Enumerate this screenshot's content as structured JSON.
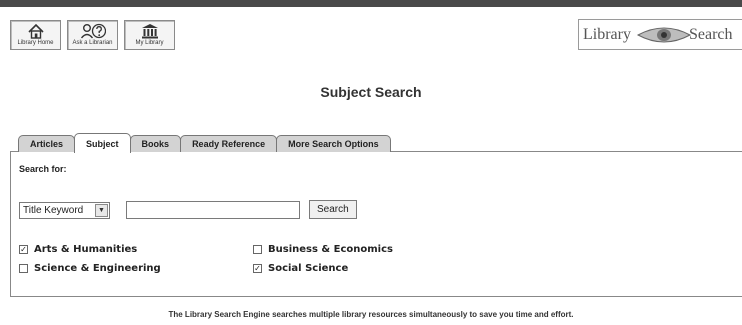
{
  "nav": {
    "buttons": [
      {
        "label": "Library Home",
        "icon": "home-icon"
      },
      {
        "label": "Ask a Librarian",
        "icon": "ask-librarian-icon"
      },
      {
        "label": "My Library",
        "icon": "library-building-icon"
      }
    ]
  },
  "logo": {
    "word1": "Library",
    "word2": "Search",
    "icon": "eye-icon"
  },
  "page_title": "Subject Search",
  "tabs": [
    {
      "label": "Articles",
      "active": false
    },
    {
      "label": "Subject",
      "active": true
    },
    {
      "label": "Books",
      "active": false
    },
    {
      "label": "Ready Reference",
      "active": false
    },
    {
      "label": "More Search Options",
      "active": false
    }
  ],
  "search": {
    "label": "Search for:",
    "select_value": "Title Keyword",
    "input_value": "",
    "button_label": "Search"
  },
  "subjects": [
    {
      "label": "Arts & Humanities",
      "checked": true
    },
    {
      "label": "Business & Economics",
      "checked": false
    },
    {
      "label": "Science & Engineering",
      "checked": false
    },
    {
      "label": "Social Science",
      "checked": true
    }
  ],
  "footer": {
    "text": "The Library Search Engine searches multiple library resources simultaneously to save you time and effort."
  },
  "colors": {
    "topbar": "#4a4a4a",
    "tab_inactive": "#d3d3d3",
    "tab_active": "#ffffff"
  }
}
